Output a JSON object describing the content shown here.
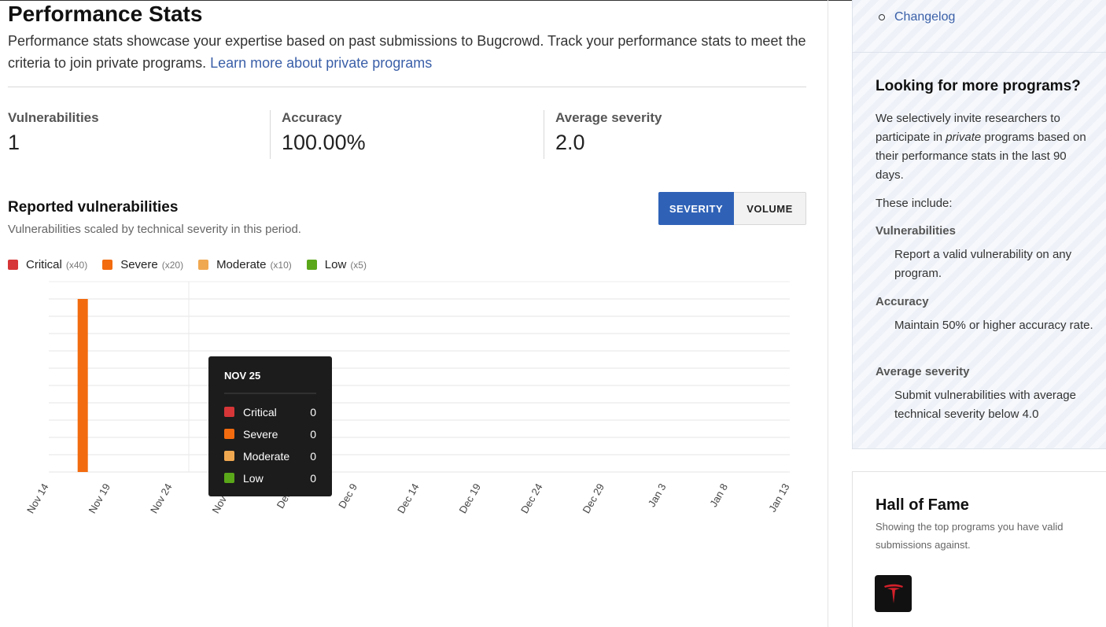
{
  "header": {
    "title": "Performance Stats",
    "intro_text": "Performance stats showcase your expertise based on past submissions to Bugcrowd. Track your performance stats to meet the criteria to join private programs.",
    "intro_link": "Learn more about private programs"
  },
  "stats": [
    {
      "label": "Vulnerabilities",
      "value": "1"
    },
    {
      "label": "Accuracy",
      "value": "100.00%"
    },
    {
      "label": "Average severity",
      "value": "2.0"
    }
  ],
  "reported": {
    "title": "Reported vulnerabilities",
    "subtitle": "Vulnerabilities scaled by technical severity in this period.",
    "toggle_severity": "SEVERITY",
    "toggle_volume": "VOLUME"
  },
  "legend": [
    {
      "label": "Critical",
      "mult": "(x40)",
      "color": "#d63638"
    },
    {
      "label": "Severe",
      "mult": "(x20)",
      "color": "#f26b0f"
    },
    {
      "label": "Moderate",
      "mult": "(x10)",
      "color": "#f0a850"
    },
    {
      "label": "Low",
      "mult": "(x5)",
      "color": "#5aa71a"
    }
  ],
  "chart_data": {
    "type": "bar",
    "categories": [
      "Nov 14",
      "Nov 19",
      "Nov 24",
      "Nov 29",
      "Dec 4",
      "Dec 9",
      "Dec 14",
      "Dec 19",
      "Dec 24",
      "Dec 29",
      "Jan 3",
      "Jan 8",
      "Jan 13"
    ],
    "series": [
      {
        "name": "Critical",
        "points": []
      },
      {
        "name": "Severe",
        "points": [
          {
            "x": "Nov 15",
            "y": 20
          }
        ]
      },
      {
        "name": "Moderate",
        "points": []
      },
      {
        "name": "Low",
        "points": []
      }
    ],
    "ylim": [
      0,
      20
    ],
    "grid": true,
    "tooltip": {
      "title": "NOV 25",
      "rows": [
        {
          "label": "Critical",
          "value": "0",
          "color": "#d63638"
        },
        {
          "label": "Severe",
          "value": "0",
          "color": "#f26b0f"
        },
        {
          "label": "Moderate",
          "value": "0",
          "color": "#f0a850"
        },
        {
          "label": "Low",
          "value": "0",
          "color": "#5aa71a"
        }
      ]
    }
  },
  "sidebar": {
    "changelog": "Changelog",
    "card": {
      "title": "Looking for more programs?",
      "p1_before": "We selectively invite researchers to participate in ",
      "p1_em": "private",
      "p1_after": " programs based on their performance stats in the last 90 days.",
      "p2": "These include:",
      "h1": "Vulnerabilities",
      "d1": "Report a valid vulnerability on any program.",
      "h2": "Accuracy",
      "d2": "Maintain 50% or higher accuracy rate.",
      "h3": "Average severity",
      "d3": "Submit vulnerabilities with average technical severity below 4.0"
    },
    "hof": {
      "title": "Hall of Fame",
      "subtitle": "Showing the top programs you have valid submissions against.",
      "logo": "tesla-logo-icon"
    }
  }
}
